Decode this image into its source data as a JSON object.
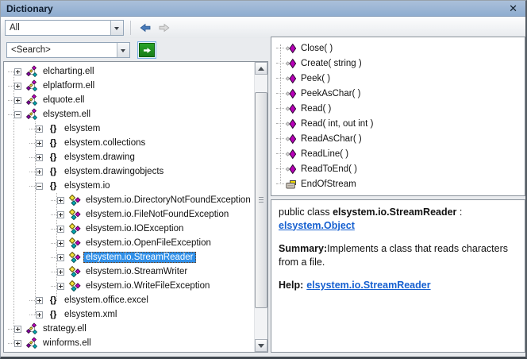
{
  "window": {
    "title": "Dictionary",
    "close_glyph": "✕"
  },
  "toolbar": {
    "filter_value": "All"
  },
  "search": {
    "value": "<Search>"
  },
  "tree": {
    "items": [
      {
        "label": "elcharting.ell",
        "type": "library",
        "level": 0,
        "expander": "plus",
        "selected": false
      },
      {
        "label": "elplatform.ell",
        "type": "library",
        "level": 0,
        "expander": "plus",
        "selected": false
      },
      {
        "label": "elquote.ell",
        "type": "library",
        "level": 0,
        "expander": "plus",
        "selected": false
      },
      {
        "label": "elsystem.ell",
        "type": "library",
        "level": 0,
        "expander": "minus",
        "selected": false
      },
      {
        "label": "elsystem",
        "type": "namespace",
        "level": 1,
        "expander": "plus",
        "selected": false
      },
      {
        "label": "elsystem.collections",
        "type": "namespace",
        "level": 1,
        "expander": "plus",
        "selected": false
      },
      {
        "label": "elsystem.drawing",
        "type": "namespace",
        "level": 1,
        "expander": "plus",
        "selected": false
      },
      {
        "label": "elsystem.drawingobjects",
        "type": "namespace",
        "level": 1,
        "expander": "plus",
        "selected": false
      },
      {
        "label": "elsystem.io",
        "type": "namespace",
        "level": 1,
        "expander": "minus",
        "selected": false
      },
      {
        "label": "elsystem.io.DirectoryNotFoundException",
        "type": "class",
        "level": 2,
        "expander": "plus",
        "selected": false
      },
      {
        "label": "elsystem.io.FileNotFoundException",
        "type": "class",
        "level": 2,
        "expander": "plus",
        "selected": false
      },
      {
        "label": "elsystem.io.IOException",
        "type": "class",
        "level": 2,
        "expander": "plus",
        "selected": false
      },
      {
        "label": "elsystem.io.OpenFileException",
        "type": "class",
        "level": 2,
        "expander": "plus",
        "selected": false
      },
      {
        "label": "elsystem.io.StreamReader",
        "type": "class",
        "level": 2,
        "expander": "plus",
        "selected": true
      },
      {
        "label": "elsystem.io.StreamWriter",
        "type": "class",
        "level": 2,
        "expander": "plus",
        "selected": false
      },
      {
        "label": "elsystem.io.WriteFileException",
        "type": "class",
        "level": 2,
        "expander": "plus",
        "selected": false
      },
      {
        "label": "elsystem.office.excel",
        "type": "namespace",
        "level": 1,
        "expander": "plus",
        "selected": false
      },
      {
        "label": "elsystem.xml",
        "type": "namespace",
        "level": 1,
        "expander": "plus",
        "selected": false
      },
      {
        "label": "strategy.ell",
        "type": "library",
        "level": 0,
        "expander": "plus",
        "selected": false
      },
      {
        "label": "winforms.ell",
        "type": "library",
        "level": 0,
        "expander": "plus",
        "selected": false
      }
    ]
  },
  "members": {
    "items": [
      {
        "label": "Close( )",
        "type": "method"
      },
      {
        "label": "Create( string )",
        "type": "method"
      },
      {
        "label": "Peek( )",
        "type": "method"
      },
      {
        "label": "PeekAsChar( )",
        "type": "method"
      },
      {
        "label": "Read( )",
        "type": "method"
      },
      {
        "label": "Read( int, out int )",
        "type": "method"
      },
      {
        "label": "ReadAsChar( )",
        "type": "method"
      },
      {
        "label": "ReadLine( )",
        "type": "method"
      },
      {
        "label": "ReadToEnd( )",
        "type": "method"
      },
      {
        "label": "EndOfStream",
        "type": "property"
      }
    ]
  },
  "details": {
    "declaration_prefix": "public class ",
    "declaration_name": "elsystem.io.StreamReader",
    "declaration_sep": " : ",
    "base_link": "elsystem.Object",
    "summary_label": "Summary:",
    "summary_text": "Implements a class that reads characters from a file.",
    "help_label": "Help:",
    "help_link": "elsystem.io.StreamReader"
  },
  "colors": {
    "titlebar": "#92AECF",
    "selection_bg": "#2F8FE8",
    "link": "#1660D0",
    "go_button_green": "#1F9A1F",
    "back_arrow_blue": "#4A7CBA",
    "diamond_magenta": "#C000C0",
    "diamond_teal": "#00A8B0",
    "diamond_yellow": "#F0E23C"
  }
}
